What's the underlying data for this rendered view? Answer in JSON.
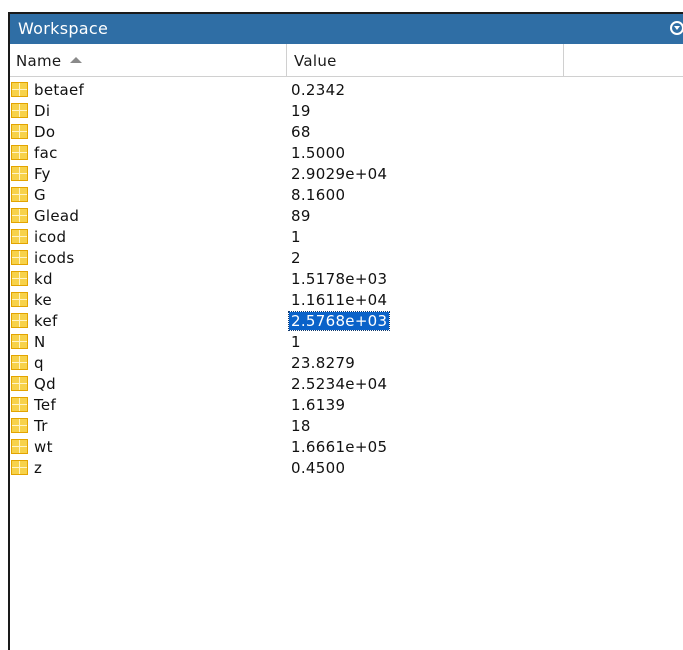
{
  "window": {
    "title": "Workspace"
  },
  "header": {
    "name": "Name",
    "value": "Value"
  },
  "icons": {
    "title_menu": "chevron-circle-icon",
    "sort": "sort-ascending-icon",
    "variable": "matrix-variable-icon"
  },
  "colors": {
    "titlebar": "#2f6ea5",
    "selection": "#0a62c9",
    "icon": "#f7d24a"
  },
  "variables": [
    {
      "name": "betaef",
      "value": "0.2342"
    },
    {
      "name": "Di",
      "value": "19"
    },
    {
      "name": "Do",
      "value": "68"
    },
    {
      "name": "fac",
      "value": "1.5000"
    },
    {
      "name": "Fy",
      "value": "2.9029e+04"
    },
    {
      "name": "G",
      "value": "8.1600"
    },
    {
      "name": "Glead",
      "value": "89"
    },
    {
      "name": "icod",
      "value": "1"
    },
    {
      "name": "icods",
      "value": "2"
    },
    {
      "name": "kd",
      "value": "1.5178e+03"
    },
    {
      "name": "ke",
      "value": "1.1611e+04"
    },
    {
      "name": "kef",
      "value": "2.5768e+03"
    },
    {
      "name": "N",
      "value": "1"
    },
    {
      "name": "q",
      "value": "23.8279"
    },
    {
      "name": "Qd",
      "value": "2.5234e+04"
    },
    {
      "name": "Tef",
      "value": "1.6139"
    },
    {
      "name": "Tr",
      "value": "18"
    },
    {
      "name": "wt",
      "value": "1.6661e+05"
    },
    {
      "name": "z",
      "value": "0.4500"
    }
  ],
  "selected_value": "2.5768e+03"
}
